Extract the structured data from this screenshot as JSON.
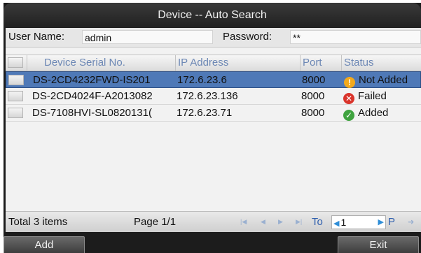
{
  "dialog": {
    "title": "Device -- Auto Search"
  },
  "credentials": {
    "username_label": "User Name:",
    "username_value": "admin",
    "password_label": "Password:",
    "password_value": "**"
  },
  "table": {
    "headers": [
      "Device Serial No.",
      "IP Address",
      "Port",
      "Status"
    ],
    "rows": [
      {
        "serial": "DS-2CD4232FWD-IS201",
        "ip": "172.6.23.6",
        "port": "8000",
        "status": "Not Added",
        "status_icon": "warning-icon",
        "selected": true
      },
      {
        "serial": "DS-2CD4024F-A2013082",
        "ip": "172.6.23.136",
        "port": "8000",
        "status": "Failed",
        "status_icon": "error-icon",
        "selected": false
      },
      {
        "serial": "DS-7108HVI-SL0820131(",
        "ip": "172.6.23.71",
        "port": "8000",
        "status": "Added",
        "status_icon": "check-icon",
        "selected": false
      }
    ]
  },
  "footer": {
    "total": "Total 3 items",
    "page": "Page 1/1",
    "to_label": "To",
    "page_input_value": "1",
    "page_suffix": "P"
  },
  "buttons": {
    "add": "Add",
    "exit": "Exit"
  },
  "colors": {
    "selected_row": "#4f79b7",
    "warning": "#f2a91c",
    "error": "#d9342b",
    "success": "#3fa33f",
    "header_text": "#6d88b5"
  }
}
